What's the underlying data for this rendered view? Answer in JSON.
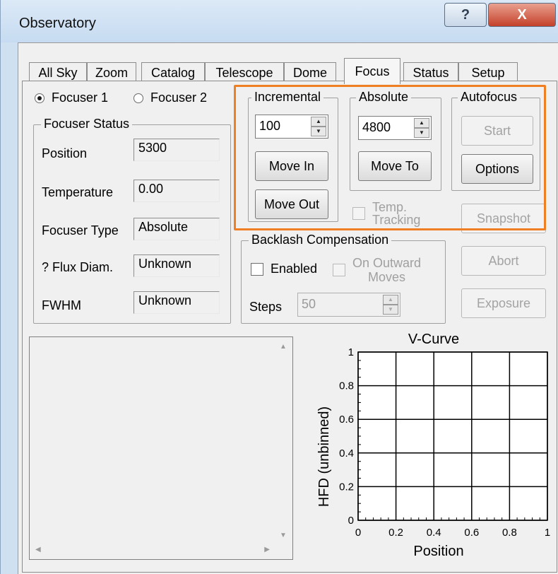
{
  "window": {
    "title": "Observatory",
    "help_glyph": "?",
    "close_glyph": "X"
  },
  "tabs": [
    {
      "label": "All Sky"
    },
    {
      "label": "Zoom"
    },
    {
      "label": "Catalog"
    },
    {
      "label": "Telescope"
    },
    {
      "label": "Dome"
    },
    {
      "label": "Focus",
      "active": true
    },
    {
      "label": "Status"
    },
    {
      "label": "Setup"
    }
  ],
  "focuser_select": {
    "option1": "Focuser 1",
    "option2": "Focuser 2",
    "selected": "Focuser 1"
  },
  "focuser_status": {
    "title": "Focuser Status",
    "position_label": "Position",
    "position_value": "5300",
    "temperature_label": "Temperature",
    "temperature_value": "0.00",
    "type_label": "Focuser Type",
    "type_value": "Absolute",
    "flux_label": "? Flux Diam.",
    "flux_value": "Unknown",
    "fwhm_label": "FWHM",
    "fwhm_value": "Unknown"
  },
  "incremental": {
    "title": "Incremental",
    "step_value": "100",
    "move_in": "Move In",
    "move_out": "Move Out"
  },
  "absolute": {
    "title": "Absolute",
    "target_value": "4800",
    "move_to": "Move To"
  },
  "autofocus": {
    "title": "Autofocus",
    "start": "Start",
    "options": "Options"
  },
  "temp_tracking": {
    "label_line1": "Temp.",
    "label_line2": "Tracking",
    "checked": false
  },
  "side_buttons": {
    "snapshot": "Snapshot",
    "abort": "Abort",
    "exposure": "Exposure"
  },
  "backlash": {
    "title": "Backlash Compensation",
    "enabled_label": "Enabled",
    "outward_line1": "On Outward",
    "outward_line2": "Moves",
    "steps_label": "Steps",
    "steps_value": "50"
  },
  "icons": {
    "spin_up": "▲",
    "spin_down": "▼",
    "scroll_up": "▲",
    "scroll_down": "▼",
    "scroll_left": "◀",
    "scroll_right": "▶"
  },
  "colors": {
    "highlight": "#f07f23",
    "close_button": "#c4402a"
  },
  "chart_data": {
    "type": "scatter",
    "title": "V-Curve",
    "xlabel": "Position",
    "ylabel": "HFD (unbinned)",
    "xlim": [
      0,
      1
    ],
    "ylim": [
      0,
      1
    ],
    "x_ticks": [
      "0",
      "0.2",
      "0.4",
      "0.6",
      "0.8",
      "1"
    ],
    "y_ticks": [
      "0",
      "0.2",
      "0.4",
      "0.6",
      "0.8",
      "1"
    ],
    "grid": true,
    "series": []
  }
}
